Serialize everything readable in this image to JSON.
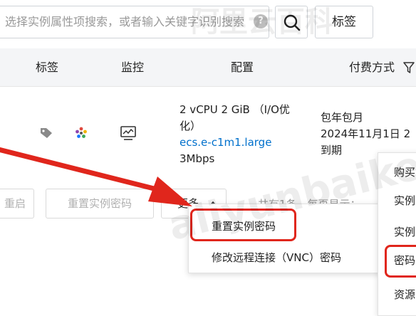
{
  "search": {
    "placeholder": "选择实例属性项搜索，或者输入关键字识别搜索",
    "help_glyph": "?"
  },
  "toolbar": {
    "tags_label": "标签"
  },
  "columns": {
    "tags": "标签",
    "monitor": "监控",
    "config": "配置",
    "billing": "付费方式"
  },
  "row": {
    "config_line1": "2 vCPU 2 GiB （I/O优",
    "config_line2": "化）",
    "instance_type": "ecs.e-c1m1.large",
    "bandwidth": "3Mbps",
    "billing_line1": "包年包月",
    "billing_line2": "2024年11月1日 2",
    "billing_line3": "到期"
  },
  "actions": {
    "restart": "重启",
    "reset_password": "重置实例密码",
    "more": "更多"
  },
  "pagination": {
    "summary": "共有1条，每页显示："
  },
  "more_menu": {
    "items": [
      "重置实例密码",
      "修改远程连接（VNC）密码"
    ]
  },
  "side_menu": {
    "items": [
      "购买",
      "实例",
      "实例",
      "密码",
      "资源"
    ]
  },
  "watermark": {
    "brand": "阿里云百科",
    "latin": "aliyunbaike.com"
  },
  "colors": {
    "annotation_red": "#e0261c",
    "link_blue": "#0070cc"
  }
}
